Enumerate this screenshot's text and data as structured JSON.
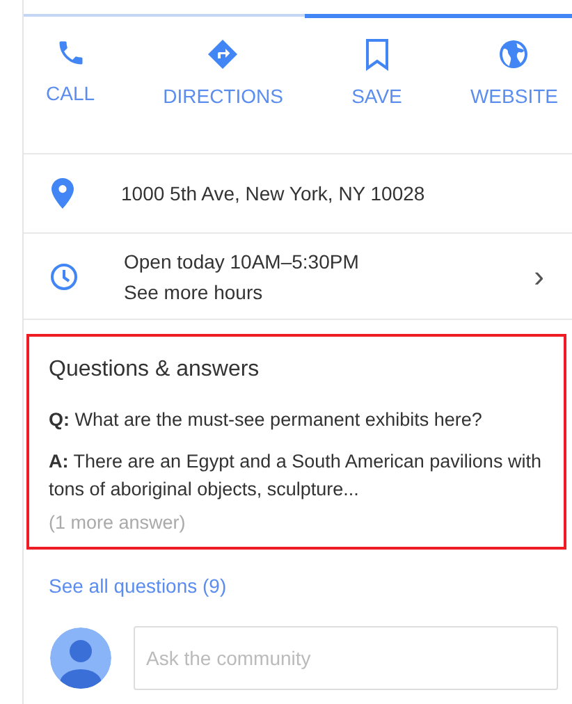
{
  "actions": [
    {
      "kind": "phone",
      "label": "CALL"
    },
    {
      "kind": "directions",
      "label": "DIRECTIONS"
    },
    {
      "kind": "bookmark",
      "label": "SAVE"
    },
    {
      "kind": "globe",
      "label": "WEBSITE"
    }
  ],
  "address": "1000 5th Ave, New York, NY 10028",
  "hours": {
    "status": "Open today 10AM–5:30PM",
    "link": "See more hours",
    "arrow": "›"
  },
  "qa": {
    "title": "Questions & answers",
    "highlighted": true,
    "question": "**Q:** What are the must-see permanent exhibits here?",
    "answer": "**A:** There are an Egypt and a South American pavilions with tons of aboriginal objects, sculpture...",
    "more": "(1 more answer)"
  },
  "see_all": "See all questions (9)",
  "ask_field": {
    "placeholder": "Ask the community"
  }
}
